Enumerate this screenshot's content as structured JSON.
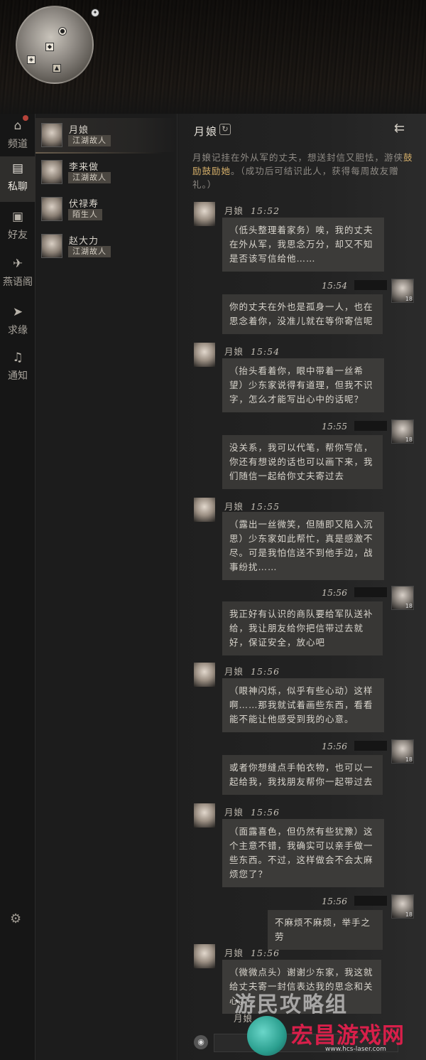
{
  "nav": {
    "items": [
      {
        "label": "频道",
        "icon": "house-icon"
      },
      {
        "label": "私聊",
        "icon": "chat-bubble-icon"
      },
      {
        "label": "好友",
        "icon": "contact-card-icon"
      },
      {
        "label": "燕语阁",
        "icon": "swallow-icon"
      },
      {
        "label": "求缘",
        "icon": "paper-plane-icon"
      },
      {
        "label": "通知",
        "icon": "bell-icon"
      }
    ],
    "active": "私聊"
  },
  "contacts": [
    {
      "name": "月娘",
      "tag": "江湖故人"
    },
    {
      "name": "李来做",
      "tag": "江湖故人"
    },
    {
      "name": "伏禄寿",
      "tag": "陌生人"
    },
    {
      "name": "赵大力",
      "tag": "江湖故人"
    }
  ],
  "chat": {
    "title": "月娘",
    "intro_pre": "月娘记挂在外从军的丈夫，想送封信又胆怯，游侠",
    "intro_highlight": "鼓励鼓励她",
    "intro_post": "。（成功后可结识此人，获得每周故友赠礼。）",
    "messages": [
      {
        "from": "npc",
        "name": "月娘",
        "time": "15:52",
        "text": "（低头整理着家务）唉，我的丈夫在外从军，我思念万分，却又不知是否该写信给他……"
      },
      {
        "from": "me",
        "time": "15:54",
        "level": "18",
        "text": "你的丈夫在外也是孤身一人，也在思念着你，没准儿就在等你寄信呢"
      },
      {
        "from": "npc",
        "name": "月娘",
        "time": "15:54",
        "text": "（抬头看着你，眼中带着一丝希望）少东家说得有道理，但我不识字，怎么才能写出心中的话呢？"
      },
      {
        "from": "me",
        "time": "15:55",
        "level": "18",
        "text": "没关系，我可以代笔，帮你写信，你还有想说的话也可以画下来，我们随信一起给你丈夫寄过去"
      },
      {
        "from": "npc",
        "name": "月娘",
        "time": "15:55",
        "text": "（露出一丝微笑，但随即又陷入沉思）少东家如此帮忙，真是感激不尽。可是我怕信送不到他手边，战事纷扰……"
      },
      {
        "from": "me",
        "time": "15:56",
        "level": "18",
        "text": "我正好有认识的商队要给军队送补给，我让朋友给你把信带过去就好，保证安全，放心吧"
      },
      {
        "from": "npc",
        "name": "月娘",
        "time": "15:56",
        "text": "（眼神闪烁，似乎有些心动）这样啊……那我就试着画些东西，看看能不能让他感受到我的心意。"
      },
      {
        "from": "me",
        "time": "15:56",
        "level": "18",
        "text": "或者你想缝点手帕衣物，也可以一起给我，我找朋友帮你一起带过去"
      },
      {
        "from": "npc",
        "name": "月娘",
        "time": "15:56",
        "text": "（面露喜色，但仍然有些犹豫）这个主意不错，我确实可以亲手做一些东西。不过，这样做会不会太麻烦您了？"
      },
      {
        "from": "me",
        "time": "15:56",
        "level": "18",
        "text": "不麻烦不麻烦，举手之劳"
      },
      {
        "from": "npc",
        "name": "月娘",
        "time": "15:56",
        "text": "（微微点头）谢谢少东家，我这就给丈夫寄一封信表达我的思念和关心。"
      }
    ],
    "partial_name": "月娘"
  },
  "watermark": {
    "text": "游民攻略组",
    "logo_text": "宏昌游戏网",
    "logo_url": "www.hcs-laser.com"
  }
}
